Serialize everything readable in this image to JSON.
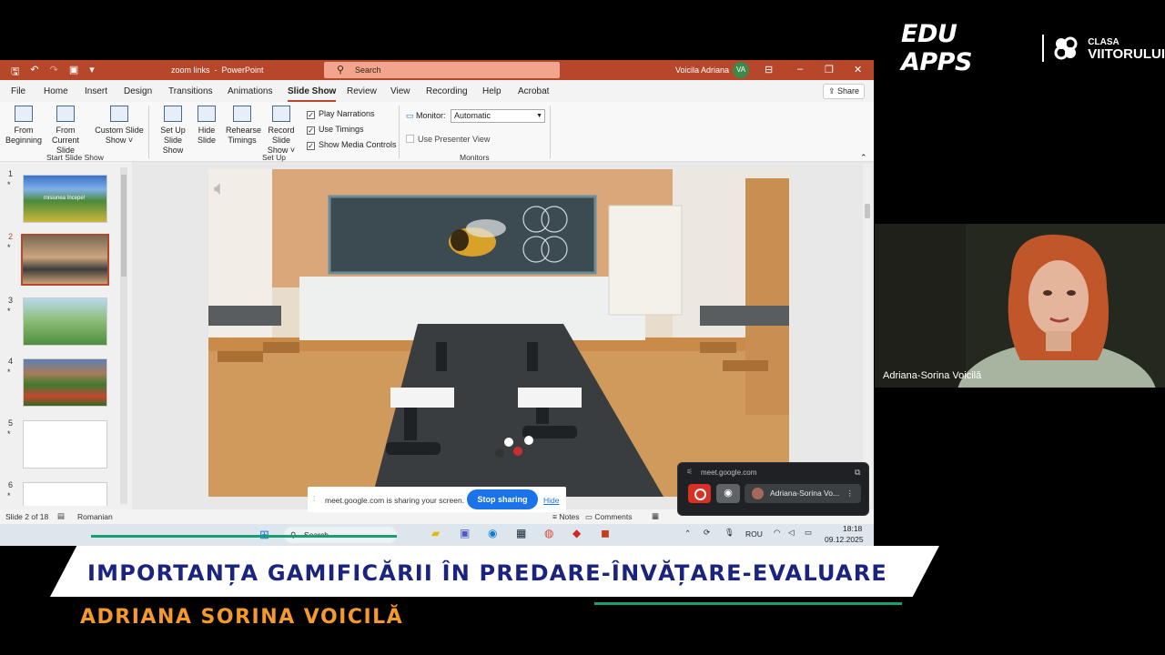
{
  "branding": {
    "edu_apps": "EDU APPS",
    "clasa": "CLASA",
    "viitorului": "VIITORULUI",
    "colors": {
      "accent_orange": "#f59a2a",
      "title_navy": "#1a237e",
      "green": "#1a9f73"
    }
  },
  "powerpoint": {
    "titlebar": {
      "document": "zoom links",
      "app": "PowerPoint",
      "search_label": "Search",
      "user": "Voicila Adriana",
      "user_initials": "VA"
    },
    "tabs": [
      "File",
      "Home",
      "Insert",
      "Design",
      "Transitions",
      "Animations",
      "Slide Show",
      "Review",
      "View",
      "Recording",
      "Help",
      "Acrobat"
    ],
    "active_tab": "Slide Show",
    "share_label": "Share",
    "ribbon": {
      "start_group": "Start Slide Show",
      "setup_group": "Set Up",
      "monitors_group": "Monitors",
      "from_beginning": [
        "From",
        "Beginning"
      ],
      "from_current": [
        "From",
        "Current Slide"
      ],
      "custom_show": [
        "Custom Slide",
        "Show ˅"
      ],
      "set_up_show": [
        "Set Up",
        "Slide Show"
      ],
      "hide_slide": [
        "Hide",
        "Slide"
      ],
      "rehearse": [
        "Rehearse",
        "Timings"
      ],
      "record": [
        "Record Slide",
        "Show ˅"
      ],
      "play_narrations": "Play Narrations",
      "use_timings": "Use Timings",
      "show_media_controls": "Show Media Controls",
      "monitor_label": "Monitor:",
      "monitor_value": "Automatic",
      "use_presenter_view": "Use Presenter View"
    },
    "slides": [
      {
        "num": "1",
        "caption": "misiunea începe!"
      },
      {
        "num": "2",
        "caption": ""
      },
      {
        "num": "3",
        "caption": ""
      },
      {
        "num": "4",
        "caption": ""
      },
      {
        "num": "5",
        "caption": ""
      },
      {
        "num": "6",
        "caption": ""
      }
    ],
    "status": {
      "slide_of": "Slide 2 of 18",
      "language": "Romanian",
      "notes": "Notes",
      "comments": "Comments"
    }
  },
  "taskbar": {
    "search": "Search",
    "lang": "ROU",
    "time": "18:18",
    "date": "09.12.2025"
  },
  "meet": {
    "share_message": "meet.google.com is sharing your screen.",
    "stop_sharing": "Stop sharing",
    "hide": "Hide",
    "pip_url": "meet.google.com",
    "pip_participant": "Adriana-Sorina Vo...",
    "camera_name": "Adriana-Sorina Voicilă"
  },
  "lower_third": {
    "title": "IMPORTANȚA GAMIFICĂRII ÎN PREDARE-ÎNVĂȚARE-EVALUARE",
    "presenter": "ADRIANA SORINA VOICILĂ"
  }
}
